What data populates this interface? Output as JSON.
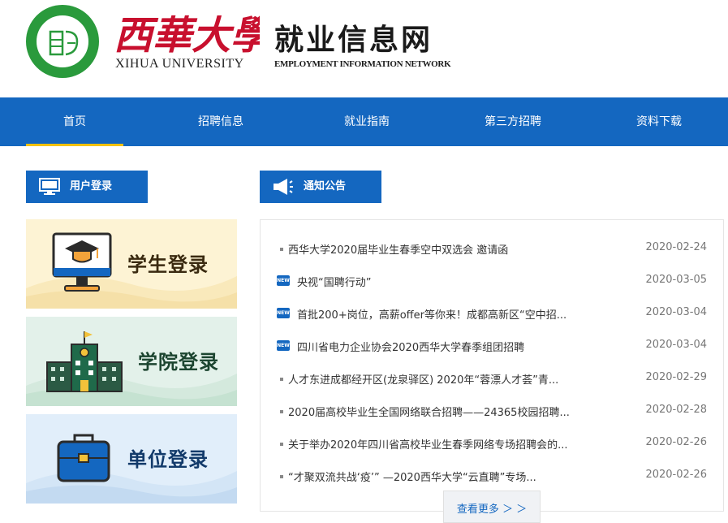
{
  "header": {
    "seal_text": "XIHUA UNIVERSITY",
    "brand_cn": "西華大學",
    "brand_en": "XIHUA UNIVERSITY",
    "site_title": "就业信息网",
    "site_subtitle": "EMPLOYMENT INFORMATION NETWORK"
  },
  "nav": {
    "items": [
      {
        "label": "首页",
        "active": true
      },
      {
        "label": "招聘信息",
        "active": false
      },
      {
        "label": "就业指南",
        "active": false
      },
      {
        "label": "第三方招聘",
        "active": false
      },
      {
        "label": "资料下载",
        "active": false
      }
    ]
  },
  "login": {
    "heading": "用户登录",
    "cards": [
      {
        "label": "学生登录",
        "icon": "graduation-cap-monitor-icon",
        "bg": "#fdf3d4",
        "color": "#3a2a10"
      },
      {
        "label": "学院登录",
        "icon": "building-icon",
        "bg": "#e3f1ea",
        "color": "#1c4530"
      },
      {
        "label": "单位登录",
        "icon": "briefcase-icon",
        "bg": "#e1eefa",
        "color": "#123a6a"
      }
    ]
  },
  "notices": {
    "heading": "通知公告",
    "more_label": "查看更多 ＞ ＞",
    "items": [
      {
        "title": "西华大学2020届毕业生春季空中双选会 邀请函",
        "date": "2020-02-24",
        "is_new": false
      },
      {
        "title": "央视“国聘行动”",
        "date": "2020-03-05",
        "is_new": true
      },
      {
        "title": "首批200+岗位，高薪offer等你来！成都高新区“空中招...",
        "date": "2020-03-04",
        "is_new": true
      },
      {
        "title": "四川省电力企业协会2020西华大学春季组团招聘",
        "date": "2020-03-04",
        "is_new": true
      },
      {
        "title": "人才东进成都经开区(龙泉驿区) 2020年“蓉漂人才荟”青...",
        "date": "2020-02-29",
        "is_new": false
      },
      {
        "title": "2020届高校毕业生全国网络联合招聘——24365校园招聘...",
        "date": "2020-02-28",
        "is_new": false
      },
      {
        "title": "关于举办2020年四川省高校毕业生春季网络专场招聘会的...",
        "date": "2020-02-26",
        "is_new": false
      },
      {
        "title": "“才聚双流共战‘疫’” —2020西华大学“云直聘”专场...",
        "date": "2020-02-26",
        "is_new": false
      }
    ]
  },
  "colors": {
    "primary": "#1467c0",
    "accent": "#f4c20d",
    "seal_green": "#2a9a3c",
    "brand_red": "#c8102e"
  }
}
